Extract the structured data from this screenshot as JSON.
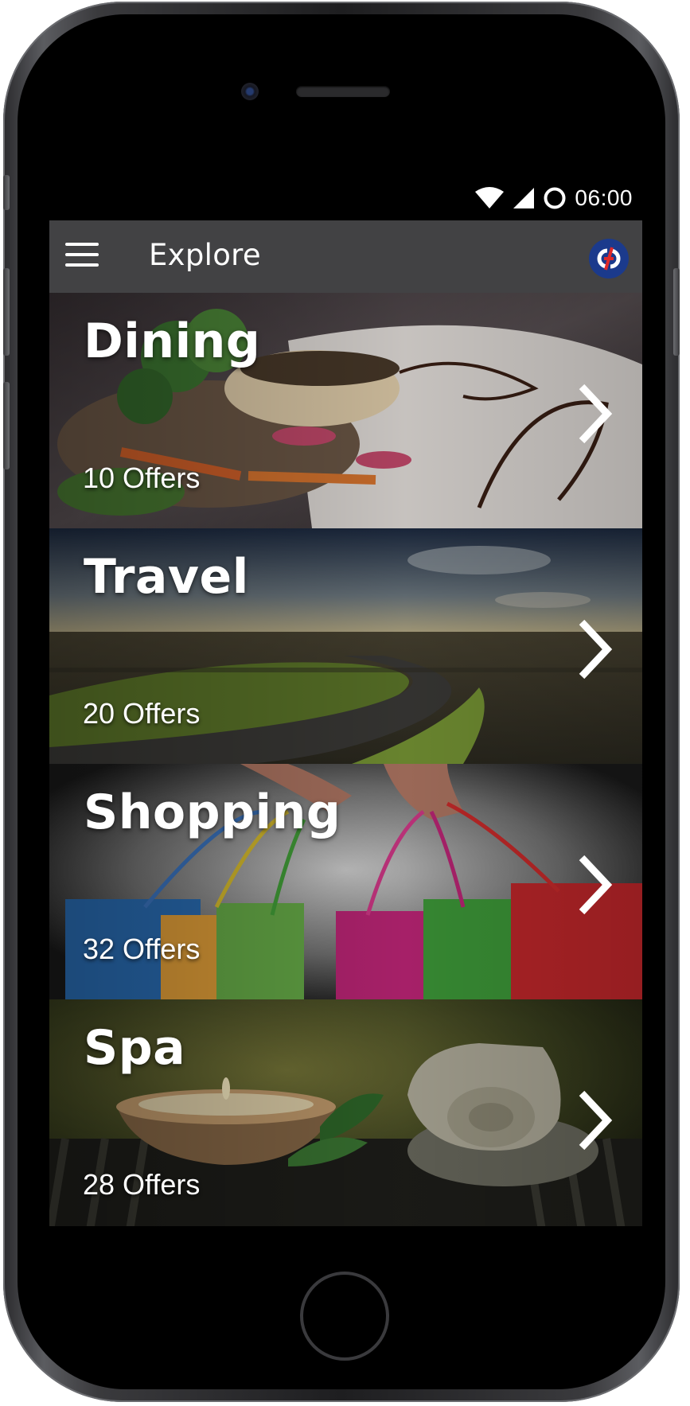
{
  "status_bar": {
    "time": "06:00",
    "icons": [
      "wifi-icon",
      "cellular-signal-icon",
      "circle-status-icon"
    ]
  },
  "app_bar": {
    "title": "Explore",
    "menu_icon": "hamburger-menu-icon",
    "logo": "brand-logo"
  },
  "categories": [
    {
      "title": "Dining",
      "offers": "10 Offers",
      "image": "plated-fish-dish"
    },
    {
      "title": "Travel",
      "offers": "20 Offers",
      "image": "winding-country-road"
    },
    {
      "title": "Shopping",
      "offers": "32 Offers",
      "image": "hands-holding-shopping-bags"
    },
    {
      "title": "Spa",
      "offers": "28 Offers",
      "image": "candle-and-rolled-towel"
    }
  ],
  "colors": {
    "app_bar": "#424244",
    "screen_bg": "#000000",
    "text": "#ffffff",
    "logo_blue": "#1b3a8c",
    "logo_red": "#e02a2a"
  }
}
